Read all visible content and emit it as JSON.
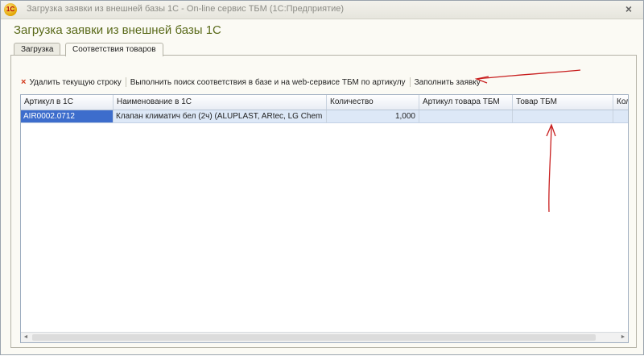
{
  "window": {
    "title": "Загрузка заявки из внешней базы 1С - On-line сервис ТБМ  (1С:Предприятие)",
    "app_icon_text": "1С",
    "close_symbol": "×"
  },
  "form": {
    "heading": "Загрузка заявки из внешней базы 1С"
  },
  "tabs": [
    {
      "label": "Загрузка",
      "active": false
    },
    {
      "label": "Соответствия товаров",
      "active": true
    }
  ],
  "toolbar": {
    "delete_row": "Удалить текущую строку",
    "search_matches": "Выполнить поиск соответствия в базе и на web-сервисе ТБМ по артикулу",
    "fill_order": "Заполнить заявку",
    "delete_icon": "×"
  },
  "grid": {
    "columns": [
      "Артикул в 1С",
      "Наименование в 1С",
      "Количество",
      "Артикул товара ТБМ",
      "Товар ТБМ",
      "Кол"
    ],
    "rows": [
      {
        "article_1c": "AIR0002.0712",
        "name_1c": "Клапан климатич бел (2ч) (ALUPLAST, ARtec, LG Chem",
        "quantity": "1,000",
        "article_tbm": "",
        "product_tbm": "",
        "qty_tbm": ""
      }
    ],
    "selected_row_color": "#3d6dcc",
    "row_highlight_color": "#dde8f7"
  },
  "scrollbar": {
    "left_arrow": "◄",
    "right_arrow": "►"
  },
  "colors": {
    "heading": "#5a6a1a",
    "annotation": "#c81e1e"
  }
}
